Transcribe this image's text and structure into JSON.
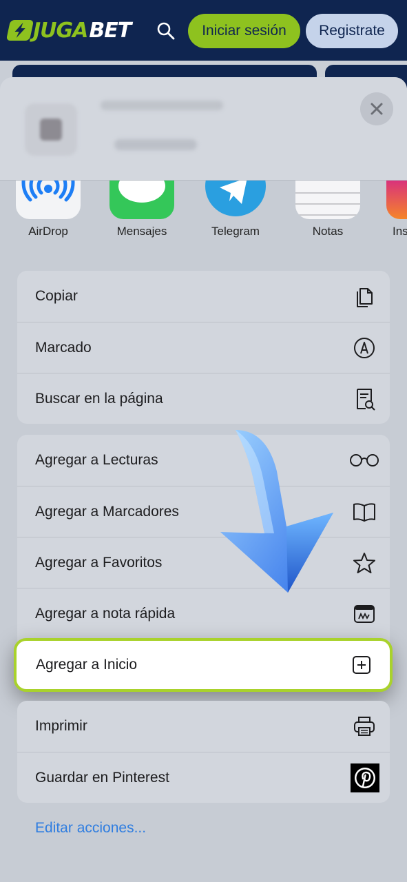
{
  "header": {
    "logo_juga": "JUGA",
    "logo_bet": "BET",
    "login_label": "Iniciar sesión",
    "register_label": "Registrate"
  },
  "apps": [
    {
      "label": "AirDrop",
      "icon": "airdrop-icon"
    },
    {
      "label": "Mensajes",
      "icon": "messages-icon"
    },
    {
      "label": "Telegram",
      "icon": "telegram-icon"
    },
    {
      "label": "Notas",
      "icon": "notes-icon"
    },
    {
      "label": "Ins",
      "icon": "instagram-icon"
    }
  ],
  "group1": [
    {
      "label": "Copiar",
      "icon": "copy-icon"
    },
    {
      "label": "Marcado",
      "icon": "markup-icon"
    },
    {
      "label": "Buscar en la página",
      "icon": "find-on-page-icon"
    }
  ],
  "group2": [
    {
      "label": "Agregar a Lecturas",
      "icon": "glasses-icon"
    },
    {
      "label": "Agregar a Marcadores",
      "icon": "book-icon"
    },
    {
      "label": "Agregar a Favoritos",
      "icon": "star-icon"
    },
    {
      "label": "Agregar a nota rápida",
      "icon": "quick-note-icon"
    },
    {
      "label": "Agregar a Inicio",
      "icon": "add-square-icon"
    }
  ],
  "group3": [
    {
      "label": "Imprimir",
      "icon": "printer-icon"
    },
    {
      "label": "Guardar en Pinterest",
      "icon": "pinterest-icon"
    }
  ],
  "edit_actions": "Editar acciones...",
  "colors": {
    "brand_navy": "#0f2550",
    "brand_green": "#8ec21f",
    "highlight_border": "#a9d22c",
    "link_blue": "#2f7de0"
  }
}
